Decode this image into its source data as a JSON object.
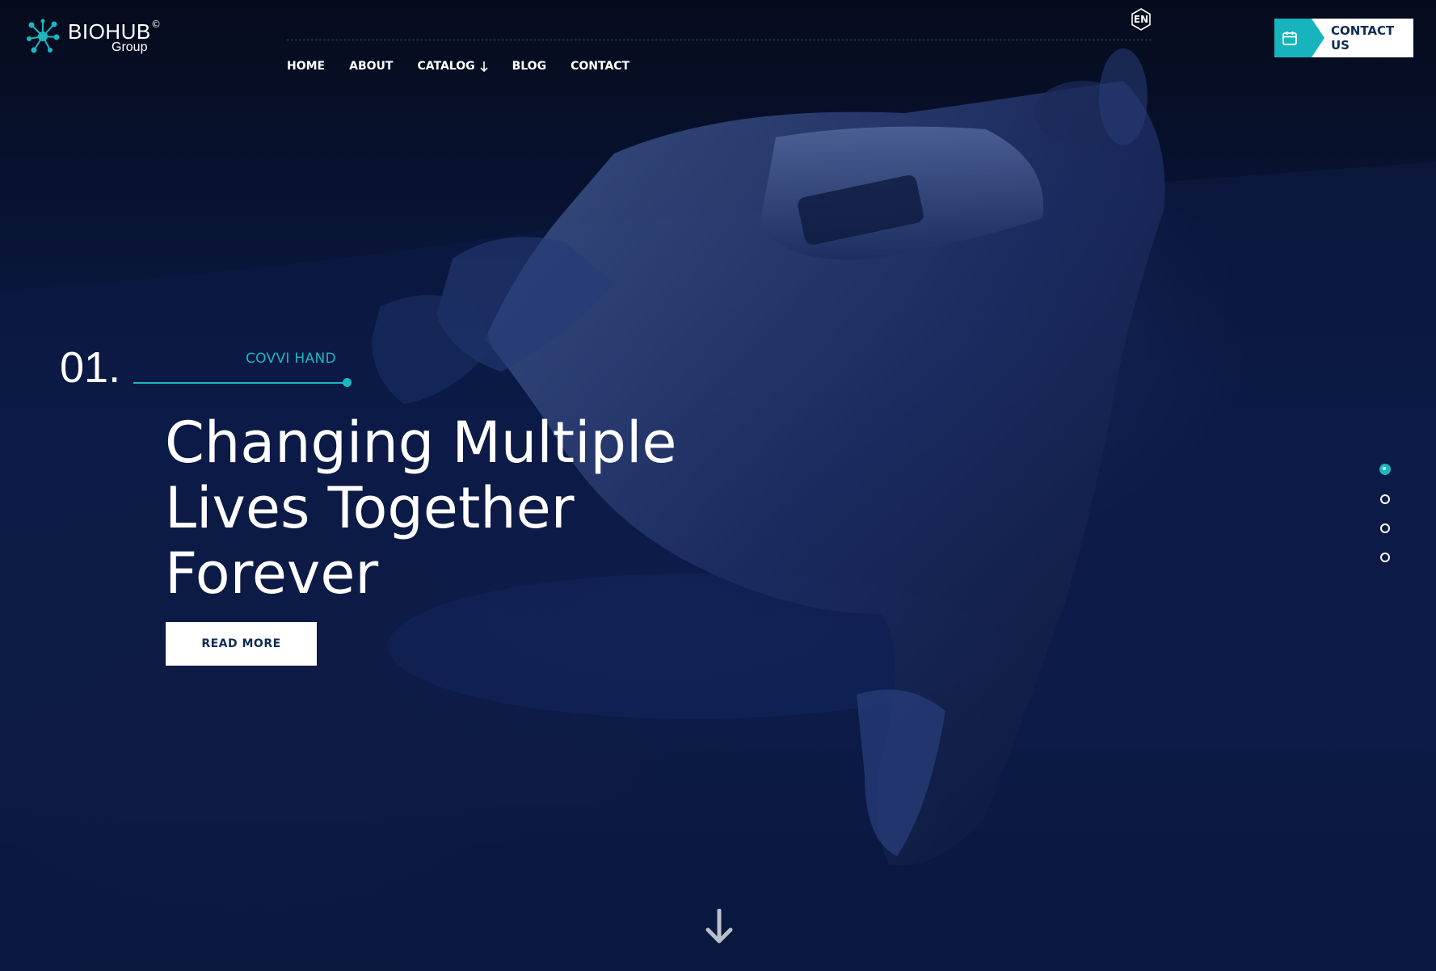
{
  "brand": {
    "name": "BIOHUB",
    "copyright_mark": "©",
    "subtitle": "Group",
    "accent_color": "#1cb7c0",
    "navy_color": "#0f2c55"
  },
  "header": {
    "language": "EN",
    "nav": [
      {
        "label": "HOME"
      },
      {
        "label": "ABOUT"
      },
      {
        "label": "CATALOG",
        "icon": "arrow-down-icon"
      },
      {
        "label": "BLOG"
      },
      {
        "label": "CONTACT"
      }
    ],
    "contact_button": {
      "label": "CONTACT US",
      "icon": "calendar-icon"
    }
  },
  "slide": {
    "number": "01.",
    "category": "COVVI HAND",
    "headline": "Changing Multiple Lives Together Forever",
    "button_label": "READ MORE"
  },
  "pagination": {
    "total": 4,
    "active_index": 0
  },
  "scroll": {
    "icon": "arrow-down-icon"
  }
}
